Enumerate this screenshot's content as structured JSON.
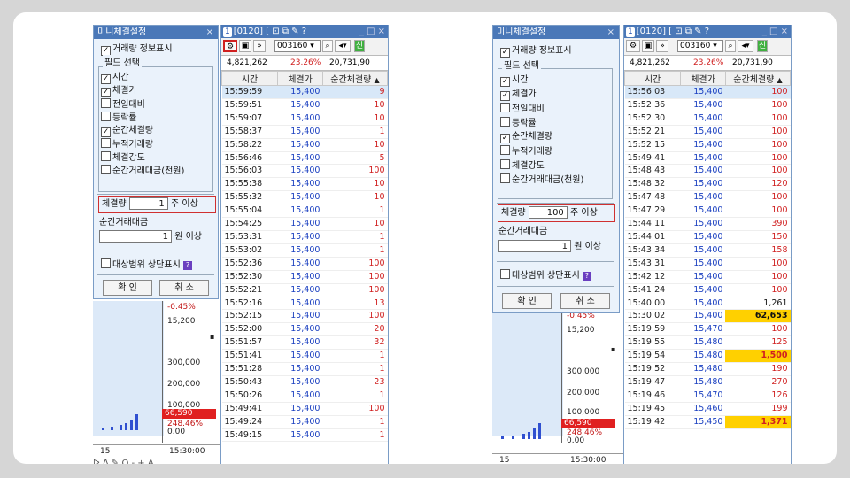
{
  "dialog": {
    "title": "미니체결설정",
    "close": "×",
    "show_info_label": "거래량 정보표시",
    "show_info_checked": true,
    "field_group_label": "필드 선택",
    "fields": [
      {
        "label": "시간",
        "checked": true
      },
      {
        "label": "체결가",
        "checked": true
      },
      {
        "label": "전일대비",
        "checked": false
      },
      {
        "label": "등락률",
        "checked": false
      },
      {
        "label": "순간체결량",
        "checked": true
      },
      {
        "label": "누적거래량",
        "checked": false
      },
      {
        "label": "체결강도",
        "checked": false
      },
      {
        "label": "순간거래대금(천원)",
        "checked": false
      }
    ],
    "volume_label": "체결량",
    "volume_unit": "주 이상",
    "amount_label": "순간거래대금",
    "amount_unit": "원 이상",
    "amount_value": "1",
    "range_label": "대상범위 상단표시",
    "help_icon": "?",
    "ok_label": "확 인",
    "cancel_label": "취 소"
  },
  "window": {
    "num": "1",
    "title": "[0120] [",
    "controls": "_ □ ×",
    "stock_code": "003160",
    "green_btn": "신",
    "price_line": [
      "4,821,262",
      "23.26%",
      "20,731,90"
    ]
  },
  "table": {
    "headers": [
      "시간",
      "체결가",
      "순간체결량"
    ]
  },
  "chart": {
    "labels": [
      "-0.45%",
      "15,200",
      "300,000",
      "200,000",
      "100,000",
      "66,590",
      "248.46%",
      "0.00"
    ],
    "foot_left": "15",
    "foot_right": "15:30:00",
    "tools": "ᐅ ᐃ ✎ Q - + A"
  },
  "colors": {
    "title_bar": "#4a78b8",
    "price": "#1a3fc0",
    "volume": "#d02020",
    "highlight": "#ffd000"
  },
  "left": {
    "volume_value": "1",
    "rows": [
      [
        "15:59:59",
        "15,400",
        "9"
      ],
      [
        "15:59:51",
        "15,400",
        "10"
      ],
      [
        "15:59:07",
        "15,400",
        "10"
      ],
      [
        "15:58:37",
        "15,400",
        "1"
      ],
      [
        "15:58:22",
        "15,400",
        "10"
      ],
      [
        "15:56:46",
        "15,400",
        "5"
      ],
      [
        "15:56:03",
        "15,400",
        "100"
      ],
      [
        "15:55:38",
        "15,400",
        "10"
      ],
      [
        "15:55:32",
        "15,400",
        "10"
      ],
      [
        "15:55:04",
        "15,400",
        "1"
      ],
      [
        "15:54:25",
        "15,400",
        "10"
      ],
      [
        "15:53:31",
        "15,400",
        "1"
      ],
      [
        "15:53:02",
        "15,400",
        "1"
      ],
      [
        "15:52:36",
        "15,400",
        "100"
      ],
      [
        "15:52:30",
        "15,400",
        "100"
      ],
      [
        "15:52:21",
        "15,400",
        "100"
      ],
      [
        "15:52:16",
        "15,400",
        "13"
      ],
      [
        "15:52:15",
        "15,400",
        "100"
      ],
      [
        "15:52:00",
        "15,400",
        "20"
      ],
      [
        "15:51:57",
        "15,400",
        "32"
      ],
      [
        "15:51:41",
        "15,400",
        "1"
      ],
      [
        "15:51:28",
        "15,400",
        "1"
      ],
      [
        "15:50:43",
        "15,400",
        "23"
      ],
      [
        "15:50:26",
        "15,400",
        "1"
      ],
      [
        "15:49:41",
        "15,400",
        "100"
      ],
      [
        "15:49:24",
        "15,400",
        "1"
      ],
      [
        "15:49:15",
        "15,400",
        "1"
      ]
    ]
  },
  "right": {
    "volume_value": "100",
    "rows": [
      [
        "15:56:03",
        "15,400",
        "100"
      ],
      [
        "15:52:36",
        "15,400",
        "100"
      ],
      [
        "15:52:30",
        "15,400",
        "100"
      ],
      [
        "15:52:21",
        "15,400",
        "100"
      ],
      [
        "15:52:15",
        "15,400",
        "100"
      ],
      [
        "15:49:41",
        "15,400",
        "100"
      ],
      [
        "15:48:43",
        "15,400",
        "100"
      ],
      [
        "15:48:32",
        "15,400",
        "120"
      ],
      [
        "15:47:48",
        "15,400",
        "100"
      ],
      [
        "15:47:29",
        "15,400",
        "100"
      ],
      [
        "15:44:11",
        "15,400",
        "390"
      ],
      [
        "15:44:01",
        "15,400",
        "150"
      ],
      [
        "15:43:34",
        "15,400",
        "158"
      ],
      [
        "15:43:31",
        "15,400",
        "100"
      ],
      [
        "15:42:12",
        "15,400",
        "100"
      ],
      [
        "15:41:24",
        "15,400",
        "100"
      ],
      [
        "15:40:00",
        "15,400",
        "1,261"
      ],
      [
        "15:30:02",
        "15,400",
        "62,653"
      ],
      [
        "15:19:59",
        "15,470",
        "100"
      ],
      [
        "15:19:55",
        "15,480",
        "125"
      ],
      [
        "15:19:54",
        "15,480",
        "1,500"
      ],
      [
        "15:19:52",
        "15,480",
        "190"
      ],
      [
        "15:19:47",
        "15,480",
        "270"
      ],
      [
        "15:19:46",
        "15,470",
        "126"
      ],
      [
        "15:19:45",
        "15,460",
        "199"
      ],
      [
        "15:19:42",
        "15,450",
        "1,371"
      ]
    ],
    "highlight_rows": [
      17,
      20,
      25
    ],
    "black_rows": [
      16,
      17
    ]
  }
}
